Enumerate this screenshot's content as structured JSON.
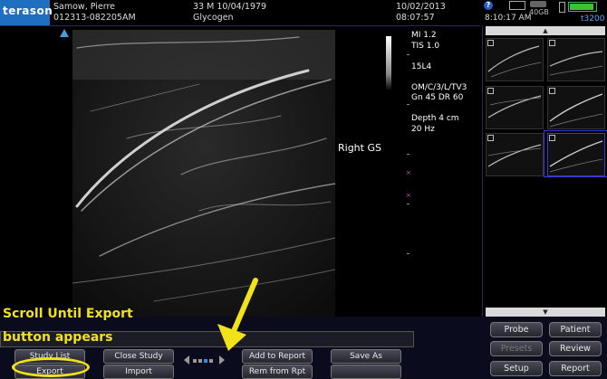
{
  "header": {
    "logo": "terason",
    "patient_name": "Samow, Pierre",
    "study_id": "012313-082205AM",
    "age_sex_dob": "33 M  10/04/1979",
    "exam_type": "Glycogen",
    "date": "10/02/2013",
    "time": "08:07:57",
    "clock": "8:10:17 AM",
    "status_label": "40GB",
    "model": "t3200"
  },
  "image": {
    "params": [
      "MI  1.2",
      "TIS 1.0",
      "",
      "15L4",
      "",
      "OM/C/3/L/TV3",
      "Gn 45   DR 60",
      "",
      "Depth 4 cm",
      "20 Hz"
    ],
    "annotation": "Right GS"
  },
  "thumbnails": {
    "count": 6,
    "selected_index": 5,
    "scroll_up": "▲",
    "scroll_down": "▼"
  },
  "overlay": {
    "line1": "Scroll Until Export",
    "line2": "button appears",
    "accent": "#f2e21a"
  },
  "buttons": {
    "study_list": "Study List",
    "export": "Export",
    "close_study": "Close Study",
    "import": "Import",
    "add_to_report": "Add to Report",
    "rem_from_rpt": "Rem from Rpt",
    "save_as": "Save As",
    "probe": "Probe",
    "patient": "Patient",
    "presets": "Presets",
    "review": "Review",
    "setup": "Setup",
    "report": "Report"
  }
}
